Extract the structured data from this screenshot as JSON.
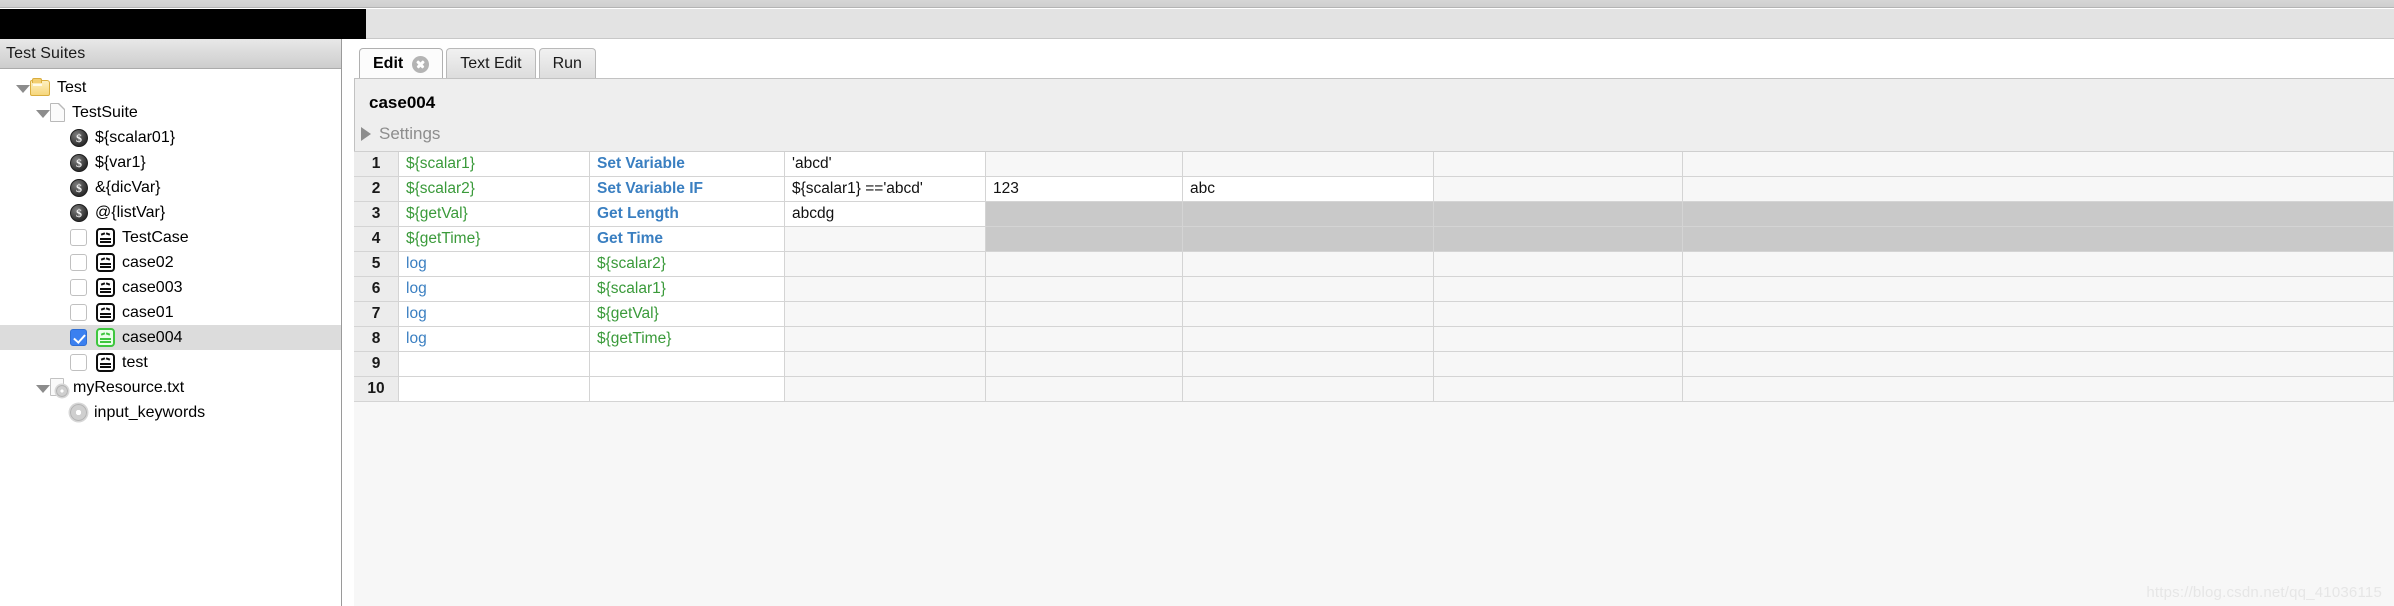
{
  "window": {
    "left_panel_title": "Test Suites"
  },
  "tree": [
    {
      "label": "Test",
      "icon": "folder-icon",
      "indent": 0,
      "twisty": "open",
      "checkbox": null,
      "selected": false
    },
    {
      "label": "TestSuite",
      "icon": "document-icon",
      "indent": 1,
      "twisty": "open",
      "checkbox": null,
      "selected": false
    },
    {
      "label": "${scalar01}",
      "icon": "variable-icon",
      "indent": 2,
      "twisty": "none",
      "checkbox": null,
      "selected": false
    },
    {
      "label": "${var1}",
      "icon": "variable-icon",
      "indent": 2,
      "twisty": "none",
      "checkbox": null,
      "selected": false
    },
    {
      "label": "&{dicVar}",
      "icon": "variable-icon",
      "indent": 2,
      "twisty": "none",
      "checkbox": null,
      "selected": false
    },
    {
      "label": "@{listVar}",
      "icon": "variable-icon",
      "indent": 2,
      "twisty": "none",
      "checkbox": null,
      "selected": false
    },
    {
      "label": "TestCase",
      "icon": "testcase-icon",
      "indent": 2,
      "twisty": "none",
      "checkbox": "off",
      "selected": false
    },
    {
      "label": "case02",
      "icon": "testcase-icon",
      "indent": 2,
      "twisty": "none",
      "checkbox": "off",
      "selected": false
    },
    {
      "label": "case003",
      "icon": "testcase-icon",
      "indent": 2,
      "twisty": "none",
      "checkbox": "off",
      "selected": false
    },
    {
      "label": "case01",
      "icon": "testcase-icon",
      "indent": 2,
      "twisty": "none",
      "checkbox": "off",
      "selected": false
    },
    {
      "label": "case004",
      "icon": "testcase-icon-passed",
      "indent": 2,
      "twisty": "none",
      "checkbox": "on",
      "selected": true
    },
    {
      "label": "test",
      "icon": "testcase-icon",
      "indent": 2,
      "twisty": "none",
      "checkbox": "off",
      "selected": false
    },
    {
      "label": "myResource.txt",
      "icon": "resource-icon",
      "indent": 1,
      "twisty": "open",
      "checkbox": null,
      "selected": false
    },
    {
      "label": "input_keywords",
      "icon": "gear-icon",
      "indent": 2,
      "twisty": "none",
      "checkbox": null,
      "selected": false
    }
  ],
  "tabs": [
    {
      "label": "Edit",
      "active": true,
      "closable": true
    },
    {
      "label": "Text Edit",
      "active": false,
      "closable": false
    },
    {
      "label": "Run",
      "active": false,
      "closable": false
    }
  ],
  "editor": {
    "case_name": "case004",
    "settings_label": "Settings"
  },
  "grid": {
    "rows": [
      {
        "n": "1",
        "cells": [
          "${scalar1}",
          "Set Variable",
          "'abcd'",
          "",
          "",
          "",
          ""
        ],
        "kinds": [
          "var",
          "kw",
          "arg",
          "arg",
          "arg",
          "arg",
          "arg"
        ],
        "trailing": "white"
      },
      {
        "n": "2",
        "cells": [
          "${scalar2}",
          "Set Variable IF",
          "${scalar1} =='abcd'",
          "123",
          "abc",
          "",
          ""
        ],
        "kinds": [
          "var",
          "kw",
          "arg",
          "arg",
          "arg",
          "arg",
          "arg"
        ],
        "trailing": "white"
      },
      {
        "n": "3",
        "cells": [
          "${getVal}",
          "Get Length",
          "abcdg",
          "",
          "",
          "",
          ""
        ],
        "kinds": [
          "var",
          "kw",
          "arg",
          "arg",
          "arg",
          "arg",
          "arg"
        ],
        "trailing": "dim"
      },
      {
        "n": "4",
        "cells": [
          "${getTime}",
          "Get Time",
          "",
          "",
          "",
          "",
          ""
        ],
        "kinds": [
          "var",
          "kw",
          "arg",
          "arg",
          "arg",
          "arg",
          "arg"
        ],
        "trailing": "dim"
      },
      {
        "n": "5",
        "cells": [
          "log",
          "${scalar2}",
          "",
          "",
          "",
          "",
          ""
        ],
        "kinds": [
          "kwp",
          "var",
          "arg",
          "arg",
          "arg",
          "arg",
          "arg"
        ],
        "trailing": "white"
      },
      {
        "n": "6",
        "cells": [
          "log",
          "${scalar1}",
          "",
          "",
          "",
          "",
          ""
        ],
        "kinds": [
          "kwp",
          "var",
          "arg",
          "arg",
          "arg",
          "arg",
          "arg"
        ],
        "trailing": "white"
      },
      {
        "n": "7",
        "cells": [
          "log",
          "${getVal}",
          "",
          "",
          "",
          "",
          ""
        ],
        "kinds": [
          "kwp",
          "var",
          "arg",
          "arg",
          "arg",
          "arg",
          "arg"
        ],
        "trailing": "white"
      },
      {
        "n": "8",
        "cells": [
          "log",
          "${getTime}",
          "",
          "",
          "",
          "",
          ""
        ],
        "kinds": [
          "kwp",
          "var",
          "arg",
          "arg",
          "arg",
          "arg",
          "arg"
        ],
        "trailing": "white"
      },
      {
        "n": "9",
        "cells": [
          "",
          "",
          "",
          "",
          "",
          "",
          ""
        ],
        "kinds": [
          "arg",
          "arg",
          "arg",
          "arg",
          "arg",
          "arg",
          "arg"
        ],
        "trailing": "white"
      },
      {
        "n": "10",
        "cells": [
          "",
          "",
          "",
          "",
          "",
          "",
          ""
        ],
        "kinds": [
          "arg",
          "arg",
          "arg",
          "arg",
          "arg",
          "arg",
          "arg"
        ],
        "trailing": "white"
      }
    ]
  },
  "watermark": "https://blog.csdn.net/qq_41036115",
  "colors": {
    "variable": "#3a9a3a",
    "keyword": "#3a7fc1",
    "selection": "#3b80f0",
    "passed": "#3ec63e"
  }
}
